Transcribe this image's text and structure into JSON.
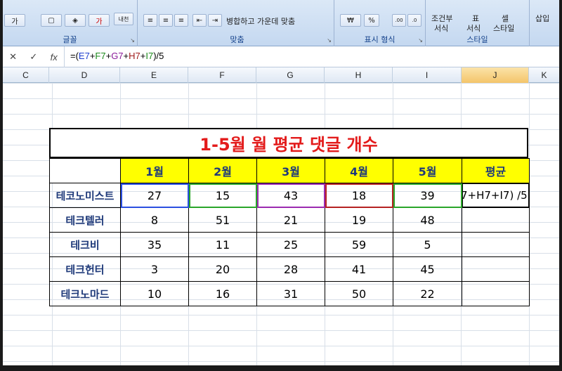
{
  "ribbon": {
    "font_group": "글꼴",
    "align_group": "맞춤",
    "number_group": "표시 형식",
    "style_group": "스타일",
    "merge_center": "병합하고 가운데 맞춤",
    "currency": "₩",
    "percent": "%",
    "conditional": "조건부",
    "conditional2": "서식",
    "table": "표",
    "table2": "서식",
    "cell": "셀",
    "cell2": "스타일",
    "insert": "삽입",
    "font_color_label": "가",
    "wrap_label": "내천"
  },
  "formula_bar": {
    "cancel": "✕",
    "enter": "✓",
    "fx": "fx",
    "prefix": "=(",
    "e": "E7",
    "plus1": "+",
    "f": "F7",
    "plus2": "+",
    "g": "G7",
    "plus3": "+",
    "h": "H7",
    "plus4": "+",
    "i": "I7",
    "suffix": ")/5"
  },
  "columns": [
    "C",
    "D",
    "E",
    "F",
    "G",
    "H",
    "I",
    "J",
    "K"
  ],
  "table": {
    "title": "1-5월 월 평균 댓글 개수",
    "headers": [
      "1월",
      "2월",
      "3월",
      "4월",
      "5월",
      "평균"
    ],
    "rows": [
      {
        "name": "테코노미스트",
        "values": [
          "27",
          "15",
          "43",
          "18",
          "39"
        ],
        "avg": "7+H7+I7) /5"
      },
      {
        "name": "테크텔러",
        "values": [
          "8",
          "51",
          "21",
          "19",
          "48"
        ],
        "avg": ""
      },
      {
        "name": "테크비",
        "values": [
          "35",
          "11",
          "25",
          "59",
          "5"
        ],
        "avg": ""
      },
      {
        "name": "테크헌터",
        "values": [
          "3",
          "20",
          "28",
          "41",
          "45"
        ],
        "avg": ""
      },
      {
        "name": "테크노마드",
        "values": [
          "10",
          "16",
          "31",
          "50",
          "22"
        ],
        "avg": ""
      }
    ]
  },
  "colors": {
    "title": "#e31b1b",
    "header_fill": "#ffff00",
    "label_text": "#1f3a7a"
  }
}
